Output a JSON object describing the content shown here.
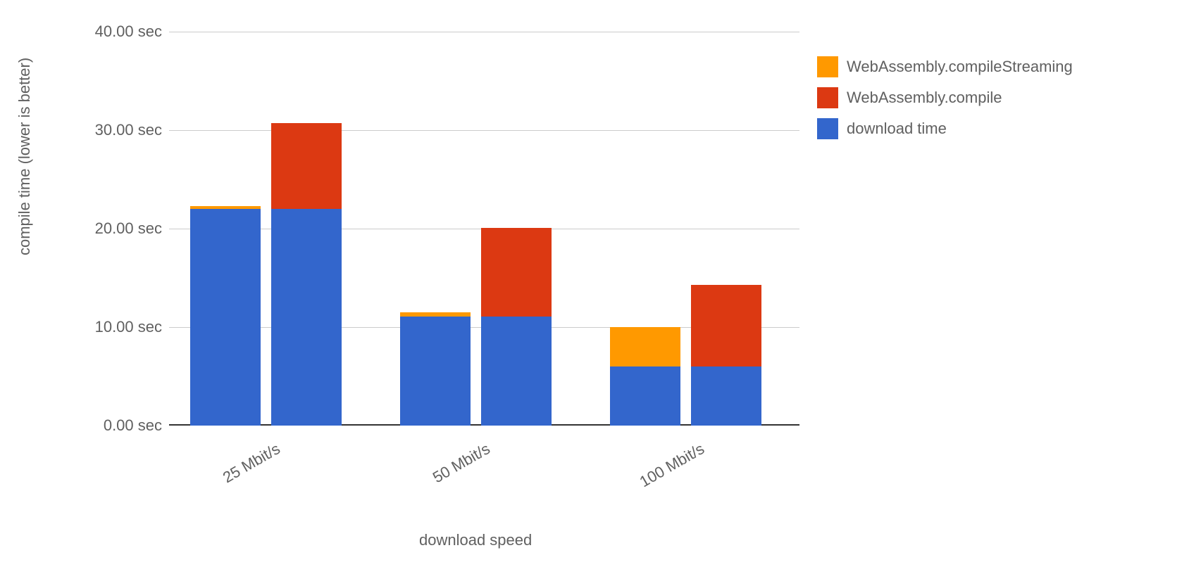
{
  "chart_data": {
    "type": "bar",
    "title": "",
    "xlabel": "download speed",
    "ylabel": "compile time (lower is better)",
    "ylim": [
      0,
      40
    ],
    "y_ticks": [
      0,
      10,
      20,
      30,
      40
    ],
    "y_tick_labels": [
      "0.00 sec",
      "10.00 sec",
      "20.00 sec",
      "30.00 sec",
      "40.00 sec"
    ],
    "categories": [
      "25 Mbit/s",
      "50 Mbit/s",
      "100 Mbit/s"
    ],
    "stack_components": [
      "download time",
      "WebAssembly.compileStreaming",
      "WebAssembly.compile"
    ],
    "groups": [
      {
        "category": "25 Mbit/s",
        "bars": [
          {
            "download": 22.0,
            "streaming": 0.3,
            "compile": 0.0
          },
          {
            "download": 22.0,
            "streaming": 0.0,
            "compile": 8.7
          }
        ]
      },
      {
        "category": "50 Mbit/s",
        "bars": [
          {
            "download": 11.1,
            "streaming": 0.4,
            "compile": 0.0
          },
          {
            "download": 11.1,
            "streaming": 0.0,
            "compile": 9.0
          }
        ]
      },
      {
        "category": "100 Mbit/s",
        "bars": [
          {
            "download": 6.0,
            "streaming": 4.0,
            "compile": 0.0
          },
          {
            "download": 6.0,
            "streaming": 0.0,
            "compile": 8.3
          }
        ]
      }
    ],
    "legend": {
      "items": [
        {
          "label": "WebAssembly.compileStreaming",
          "color": "#ff9900"
        },
        {
          "label": "WebAssembly.compile",
          "color": "#dc3912"
        },
        {
          "label": "download time",
          "color": "#3366cc"
        }
      ]
    }
  }
}
